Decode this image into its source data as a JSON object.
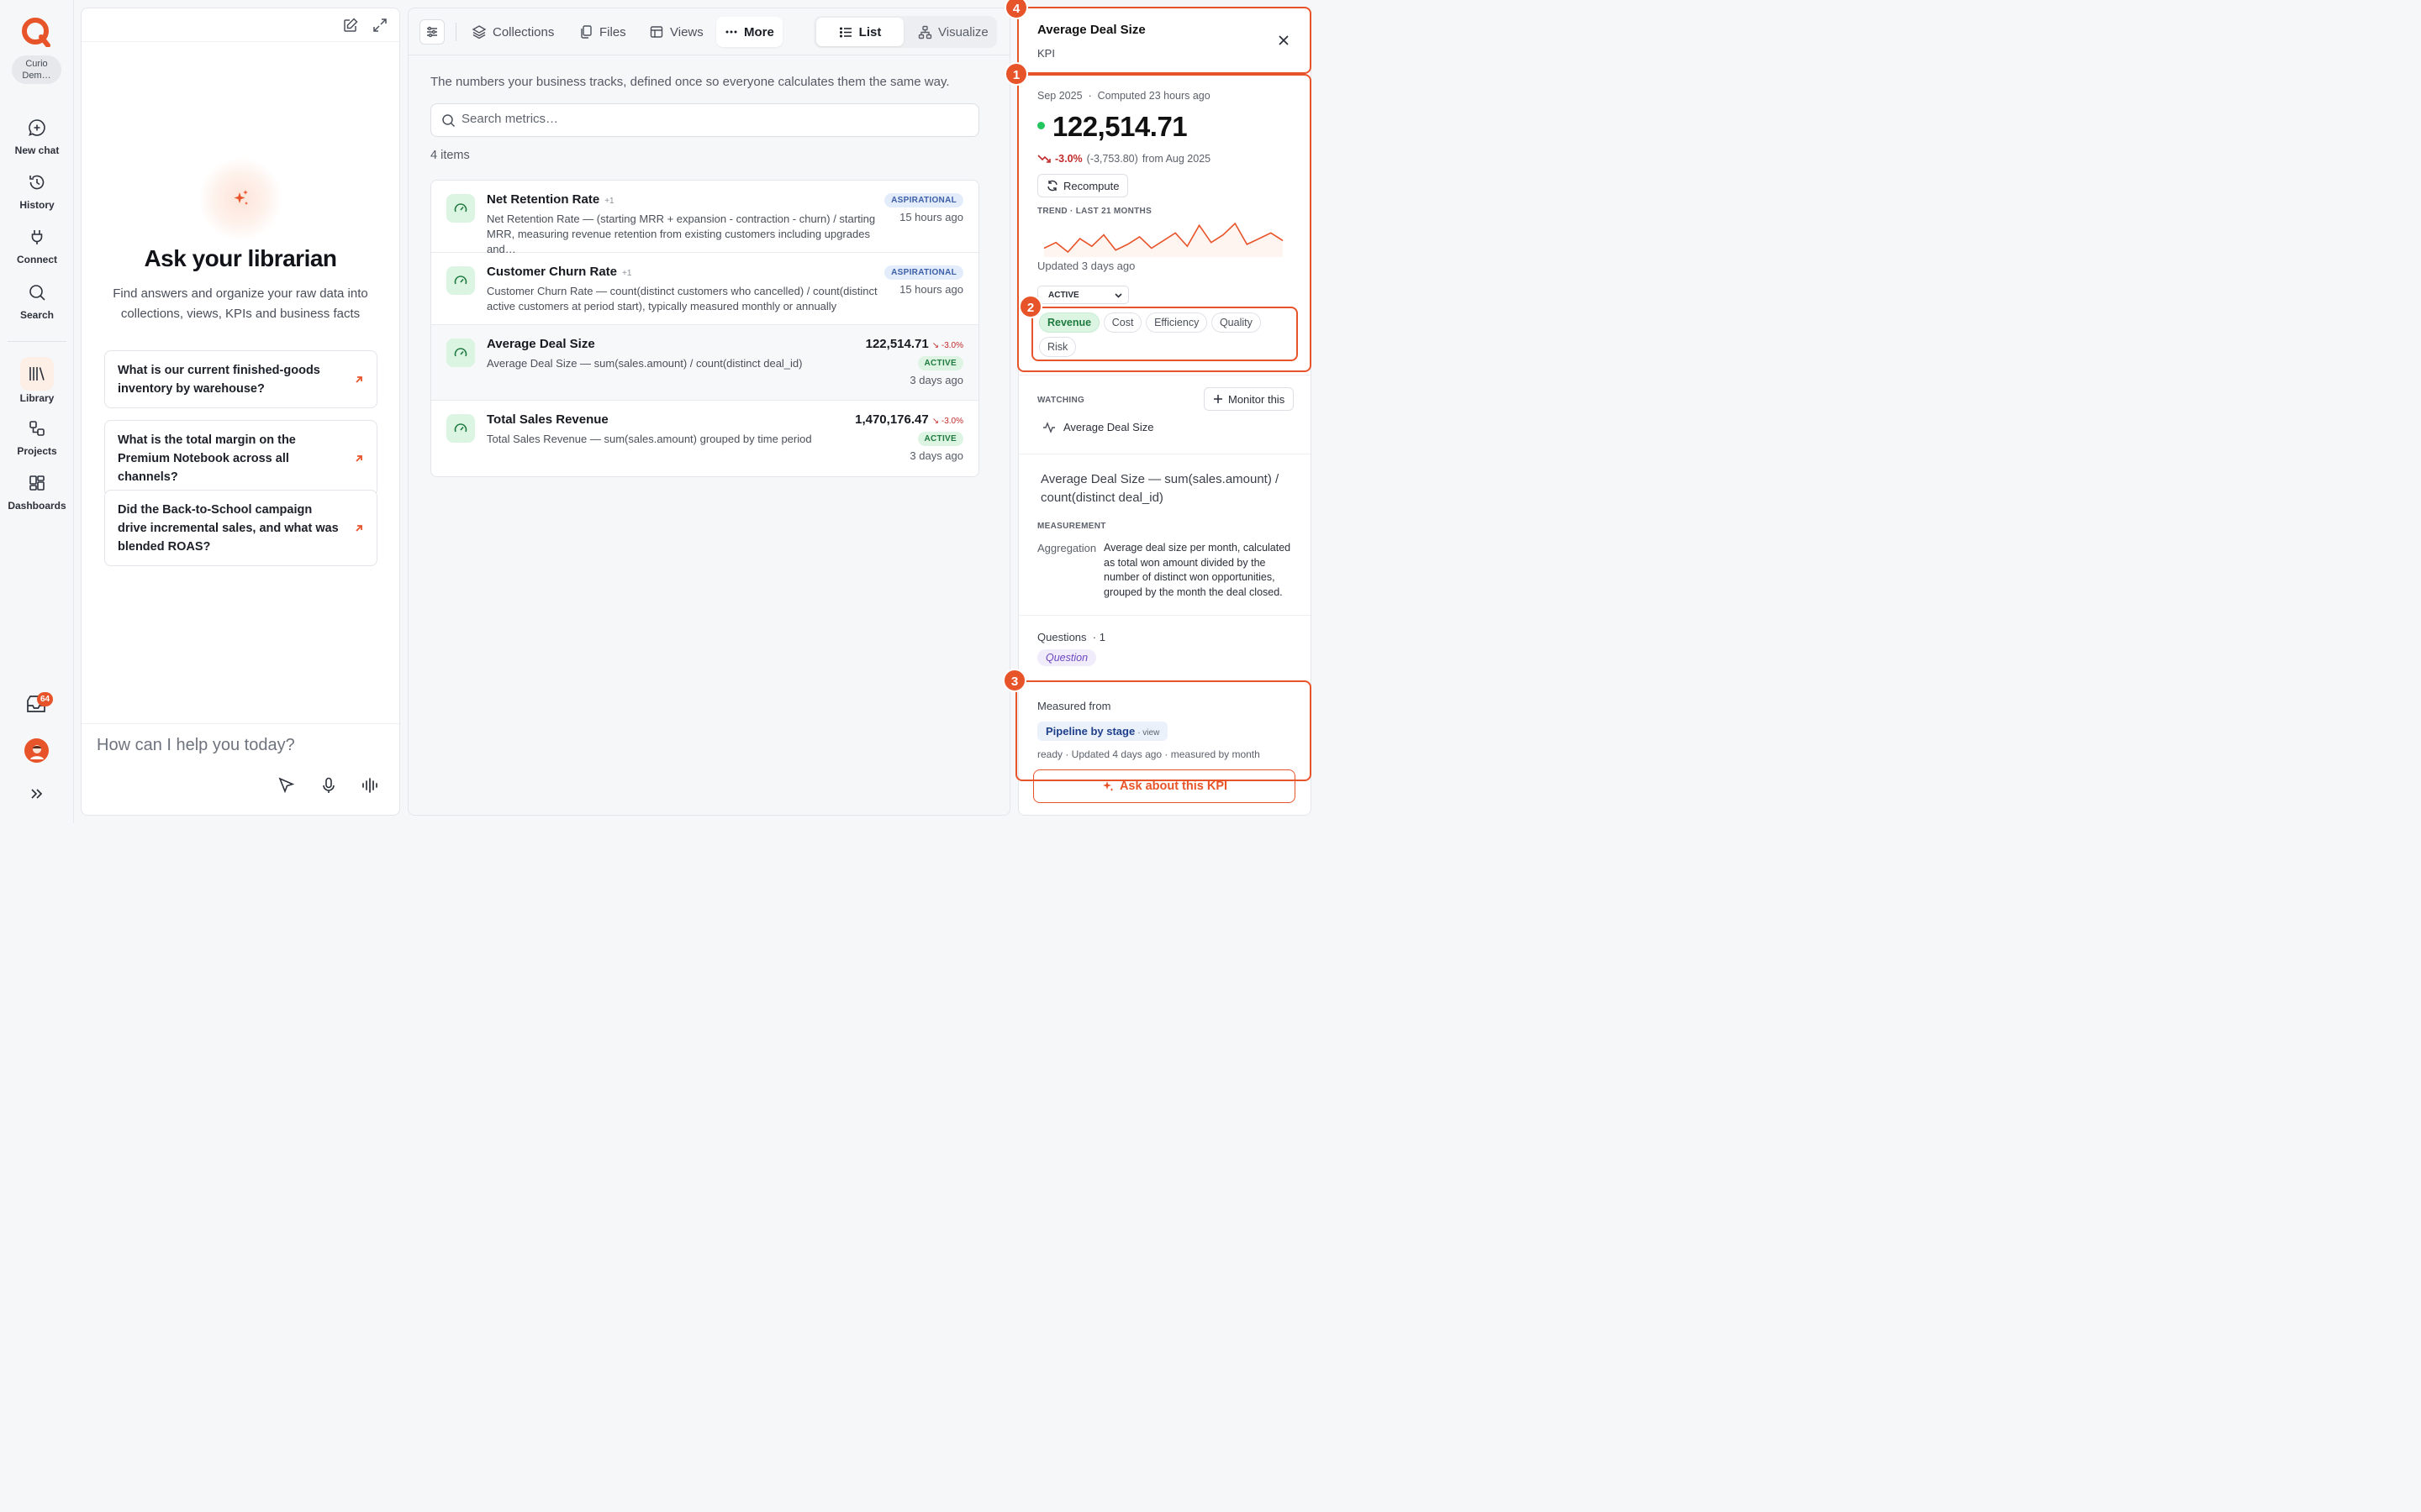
{
  "workspace": {
    "name_line1": "Curio",
    "name_line2": "Dem…"
  },
  "nav": [
    {
      "label": "New chat",
      "icon": "chat-plus-icon"
    },
    {
      "label": "History",
      "icon": "history-icon"
    },
    {
      "label": "Connect",
      "icon": "plug-icon"
    },
    {
      "label": "Search",
      "icon": "search-icon"
    },
    {
      "label": "Library",
      "icon": "library-icon",
      "active": true
    },
    {
      "label": "Projects",
      "icon": "projects-icon"
    },
    {
      "label": "Dashboards",
      "icon": "dashboards-icon"
    }
  ],
  "inbox_count": "64",
  "chat": {
    "title": "Ask your librarian",
    "subtitle": "Find answers and organize your raw data into collections, views, KPIs and business facts",
    "suggestions": [
      "What is our current finished-goods inventory by warehouse?",
      "What is the total margin on the Premium Notebook across all channels?",
      "Did the Back-to-School campaign drive incremental sales, and what was blended ROAS?"
    ],
    "input_placeholder": "How can I help you today?"
  },
  "library": {
    "tabs": [
      "Collections",
      "Files",
      "Views",
      "More"
    ],
    "view_modes": [
      "List",
      "Visualize"
    ],
    "description": "The numbers your business tracks, defined once so everyone calculates them the same way.",
    "search_placeholder": "Search metrics…",
    "count_label": "4 items",
    "items": [
      {
        "title": "Net Retention Rate",
        "plus": "+1",
        "desc": "Net Retention Rate — (starting MRR + expansion - contraction - churn) / starting MRR, measuring revenue retention from existing customers including upgrades and…",
        "status": "ASPIRATIONAL",
        "ago": "15 hours ago"
      },
      {
        "title": "Customer Churn Rate",
        "plus": "+1",
        "desc": "Customer Churn Rate — count(distinct customers who cancelled) / count(distinct active customers at period start), typically measured monthly or annually",
        "status": "ASPIRATIONAL",
        "ago": "15 hours ago"
      },
      {
        "title": "Average Deal Size",
        "desc": "Average Deal Size — sum(sales.amount) / count(distinct deal_id)",
        "value": "122,514.71",
        "change": "-3.0%",
        "status": "ACTIVE",
        "ago": "3 days ago"
      },
      {
        "title": "Total Sales Revenue",
        "desc": "Total Sales Revenue — sum(sales.amount) grouped by time period",
        "value": "1,470,176.47",
        "change": "-3.0%",
        "status": "ACTIVE",
        "ago": "3 days ago"
      }
    ]
  },
  "detail": {
    "markers": [
      "4",
      "1",
      "2",
      "3"
    ],
    "title": "Average Deal Size",
    "type": "KPI",
    "period": "Sep 2025",
    "computed": "Computed 23 hours ago",
    "value": "122,514.71",
    "delta_pct": "-3.0%",
    "delta_abs": "(-3,753.80)",
    "delta_from": "from Aug 2025",
    "recompute_label": "Recompute",
    "trend_label": "TREND · LAST 21 MONTHS",
    "trend": [
      118,
      121,
      116,
      123,
      119,
      125,
      117,
      120,
      124,
      118,
      122,
      126,
      119,
      130,
      121,
      125,
      131,
      120,
      123,
      126,
      122
    ],
    "updated": "Updated 3 days ago",
    "status": "ACTIVE",
    "categories": [
      {
        "label": "Revenue",
        "on": true
      },
      {
        "label": "Cost",
        "on": false
      },
      {
        "label": "Efficiency",
        "on": false
      },
      {
        "label": "Quality",
        "on": false
      },
      {
        "label": "Risk",
        "on": false
      }
    ],
    "watching_label": "WATCHING",
    "monitor_label": "Monitor this",
    "watching_item": "Average Deal Size",
    "definition": "Average Deal Size — sum(sales.amount) / count(distinct deal_id)",
    "measurement_label": "MEASUREMENT",
    "aggregation_key": "Aggregation",
    "aggregation_value": "Average deal size per month, calculated as total won amount divided by the number of distinct won opportunities, grouped by the month the deal closed.",
    "questions_label": "Questions",
    "questions_count": "· 1",
    "question_chip": "Question",
    "measured_from_label": "Measured from",
    "source_name": "Pipeline by stage",
    "source_type": "· view",
    "source_meta": "ready · Updated 4 days ago · measured by month",
    "ask_label": "Ask about this KPI"
  },
  "colors": {
    "accent": "#e8542a",
    "positive": "#22c55e",
    "negative": "#c22b2b"
  }
}
